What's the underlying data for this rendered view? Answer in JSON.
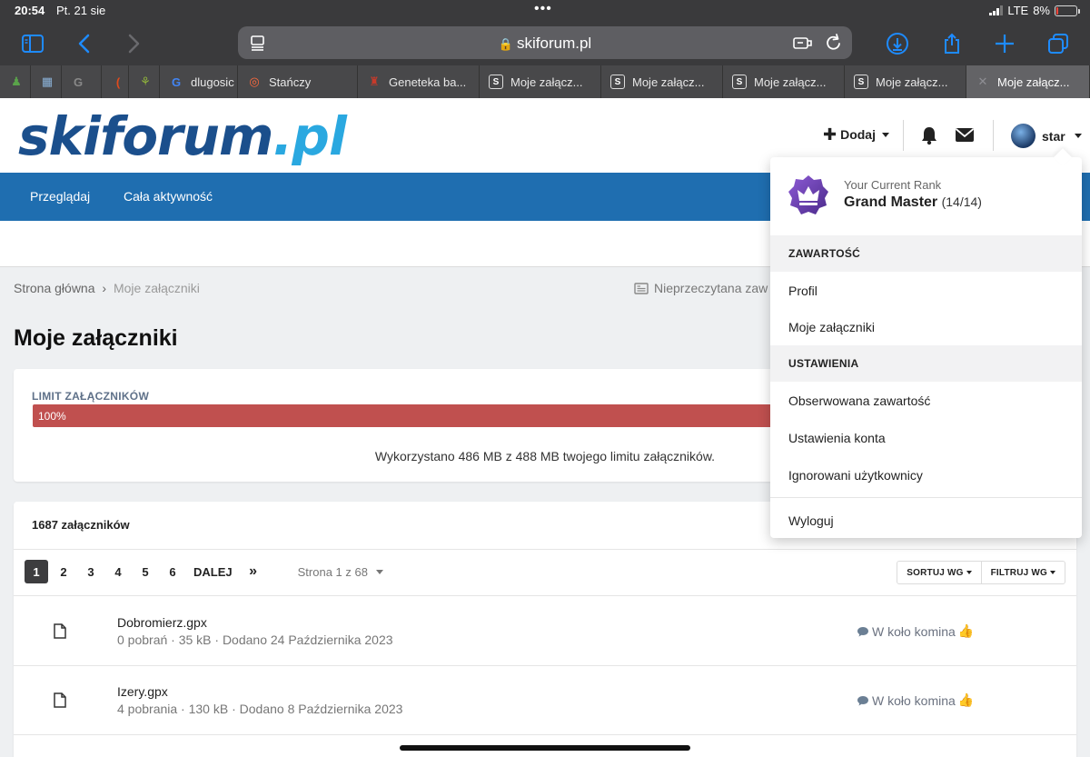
{
  "status_bar": {
    "time": "20:54",
    "date": "Pt. 21 sie",
    "network": "LTE",
    "battery": "8%",
    "battery_level": 0.08
  },
  "browser": {
    "url": "skiforum.pl",
    "tabs": [
      {
        "label": "",
        "fav": "♟",
        "fav_color": "#5aa34a",
        "width": 34
      },
      {
        "label": "",
        "fav": "▦",
        "fav_color": "#8bb2d8",
        "width": 34
      },
      {
        "label": "",
        "fav": "G",
        "fav_color": "#888888",
        "width": 44
      },
      {
        "label": "",
        "fav": "(",
        "fav_color": "#e04a1c",
        "width": 30
      },
      {
        "label": "",
        "fav": "⚘",
        "fav_color": "#90b43c",
        "width": 34
      },
      {
        "label": "dlugosic",
        "fav": "G",
        "fav_color": "#4285f4",
        "width": 86
      },
      {
        "label": "Stańczy",
        "fav": "◎",
        "fav_color": "#ff6a3c",
        "width": 132
      },
      {
        "label": "Geneteka ba...",
        "fav": "♜",
        "fav_color": "#c83a2a",
        "width": 134
      },
      {
        "label": "Moje załącz...",
        "fav": "S",
        "fav_color": "sbox",
        "width": 134
      },
      {
        "label": "Moje załącz...",
        "fav": "S",
        "fav_color": "sbox",
        "width": 134
      },
      {
        "label": "Moje załącz...",
        "fav": "S",
        "fav_color": "sbox",
        "width": 134
      },
      {
        "label": "Moje załącz...",
        "fav": "S",
        "fav_color": "sbox",
        "width": 134
      },
      {
        "label": "Moje załącz...",
        "fav": "✕",
        "fav_color": "#8e8e93",
        "width": 136,
        "active": true
      }
    ]
  },
  "site": {
    "logo_part1": "skiforum",
    "logo_part2": ".pl",
    "add_label": "Dodaj",
    "username": "star",
    "nav": [
      "Przeglądaj",
      "Cała aktywność"
    ]
  },
  "breadcrumb": {
    "home": "Strona główna",
    "sep": "›",
    "current": "Moje załączniki"
  },
  "unread_link": "Nieprzeczytana zaw",
  "page_title": "Moje załączniki",
  "limit": {
    "label": "LIMIT ZAŁĄCZNIKÓW",
    "percent_text": "100%",
    "percent": 100,
    "usage": "Wykorzystano 486 MB z 488 MB twojego limitu załączników."
  },
  "attachments": {
    "count_title": "1687 załączników",
    "pages": [
      "1",
      "2",
      "3",
      "4",
      "5",
      "6"
    ],
    "next_label": "DALEJ",
    "last_label": "»",
    "page_info": "Strona 1 z 68",
    "sort_label": "SORTUJ WG",
    "filter_label": "FILTRUJ WG",
    "rows": [
      {
        "name": "Dobromierz.gpx",
        "meta": "0 pobrań · 35 kB · Dodano 24 Października 2023",
        "topic": "W koło komina",
        "emoji": "👍"
      },
      {
        "name": "Izery.gpx",
        "meta": "4 pobrania · 130 kB · Dodano 8 Października 2023",
        "topic": "W koło komina",
        "emoji": "👍"
      }
    ]
  },
  "user_menu": {
    "rank_caption": "Your Current Rank",
    "rank_name": "Grand Master",
    "rank_count": "(14/14)",
    "section1": "ZAWARTOŚĆ",
    "items1": [
      "Profil",
      "Moje załączniki"
    ],
    "section2": "USTAWIENIA",
    "items2": [
      "Obserwowana zawartość",
      "Ustawienia konta",
      "Ignorowani użytkownicy"
    ],
    "logout": "Wyloguj"
  },
  "colors": {
    "nav_blue": "#1f6eb0",
    "progress_red": "#c0504f",
    "safari_blue": "#1e8bff"
  }
}
